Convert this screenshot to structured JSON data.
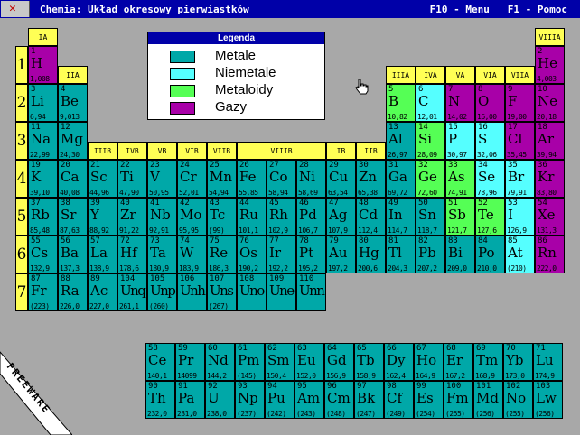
{
  "window": {
    "title": "Chemia: Układ okresowy pierwiastków",
    "menu_hint": "F10 - Menu",
    "help_hint": "F1 - Pomoc"
  },
  "legend": {
    "title": "Legenda",
    "items": [
      {
        "label": "Metale",
        "color": "#00a8a8"
      },
      {
        "label": "Niemetale",
        "color": "#55ffff"
      },
      {
        "label": "Metaloidy",
        "color": "#55ff55"
      },
      {
        "label": "Gazy",
        "color": "#a800a8"
      }
    ]
  },
  "colors": {
    "background": "#a8a8a8",
    "titlebar": "#0000a8",
    "group_header": "#ffff55"
  },
  "banner": "FREEWARE",
  "periods": [
    "1",
    "2",
    "3",
    "4",
    "5",
    "6",
    "7"
  ],
  "groups": {
    "IA": "IA",
    "IIA": "IIA",
    "IIIB": "IIIB",
    "IVB": "IVB",
    "VB": "VB",
    "VIB": "VIB",
    "VIIB": "VIIB",
    "VIIIB": "VIIIB",
    "IB": "IB",
    "IIB": "IIB",
    "IIIA": "IIIA",
    "IVA": "IVA",
    "VA": "VA",
    "VIA": "VIA",
    "VIIA": "VIIA",
    "VIIIA": "VIIIA"
  },
  "elements": [
    {
      "n": "1",
      "s": "H",
      "m": "1,008",
      "t": "gas",
      "c": 0,
      "r": 0
    },
    {
      "n": "2",
      "s": "He",
      "m": "4,003",
      "t": "gas",
      "c": 17,
      "r": 0
    },
    {
      "n": "3",
      "s": "Li",
      "m": "6,94",
      "t": "met",
      "c": 0,
      "r": 1
    },
    {
      "n": "4",
      "s": "Be",
      "m": "9,013",
      "t": "met",
      "c": 1,
      "r": 1
    },
    {
      "n": "5",
      "s": "B",
      "m": "10,82",
      "t": "mtd",
      "c": 12,
      "r": 1
    },
    {
      "n": "6",
      "s": "C",
      "m": "12,01",
      "t": "non",
      "c": 13,
      "r": 1
    },
    {
      "n": "7",
      "s": "N",
      "m": "14,02",
      "t": "gas",
      "c": 14,
      "r": 1
    },
    {
      "n": "8",
      "s": "O",
      "m": "16,00",
      "t": "gas",
      "c": 15,
      "r": 1
    },
    {
      "n": "9",
      "s": "F",
      "m": "19,00",
      "t": "gas",
      "c": 16,
      "r": 1
    },
    {
      "n": "10",
      "s": "Ne",
      "m": "20,18",
      "t": "gas",
      "c": 17,
      "r": 1
    },
    {
      "n": "11",
      "s": "Na",
      "m": "22,99",
      "t": "met",
      "c": 0,
      "r": 2
    },
    {
      "n": "12",
      "s": "Mg",
      "m": "24,30",
      "t": "met",
      "c": 1,
      "r": 2
    },
    {
      "n": "13",
      "s": "Al",
      "m": "26,97",
      "t": "met",
      "c": 12,
      "r": 2
    },
    {
      "n": "14",
      "s": "Si",
      "m": "28,09",
      "t": "mtd",
      "c": 13,
      "r": 2
    },
    {
      "n": "15",
      "s": "P",
      "m": "30,97",
      "t": "non",
      "c": 14,
      "r": 2
    },
    {
      "n": "16",
      "s": "S",
      "m": "32,06",
      "t": "non",
      "c": 15,
      "r": 2
    },
    {
      "n": "17",
      "s": "Cl",
      "m": "35,45",
      "t": "gas",
      "c": 16,
      "r": 2
    },
    {
      "n": "18",
      "s": "Ar",
      "m": "39,94",
      "t": "gas",
      "c": 17,
      "r": 2
    },
    {
      "n": "19",
      "s": "K",
      "m": "39,10",
      "t": "met",
      "c": 0,
      "r": 3
    },
    {
      "n": "20",
      "s": "Ca",
      "m": "40,08",
      "t": "met",
      "c": 1,
      "r": 3
    },
    {
      "n": "21",
      "s": "Sc",
      "m": "44,96",
      "t": "met",
      "c": 2,
      "r": 3
    },
    {
      "n": "22",
      "s": "Ti",
      "m": "47,90",
      "t": "met",
      "c": 3,
      "r": 3
    },
    {
      "n": "23",
      "s": "V",
      "m": "50,95",
      "t": "met",
      "c": 4,
      "r": 3
    },
    {
      "n": "24",
      "s": "Cr",
      "m": "52,01",
      "t": "met",
      "c": 5,
      "r": 3
    },
    {
      "n": "25",
      "s": "Mn",
      "m": "54,94",
      "t": "met",
      "c": 6,
      "r": 3
    },
    {
      "n": "26",
      "s": "Fe",
      "m": "55,85",
      "t": "met",
      "c": 7,
      "r": 3
    },
    {
      "n": "27",
      "s": "Co",
      "m": "58,94",
      "t": "met",
      "c": 8,
      "r": 3
    },
    {
      "n": "28",
      "s": "Ni",
      "m": "58,69",
      "t": "met",
      "c": 9,
      "r": 3
    },
    {
      "n": "29",
      "s": "Cu",
      "m": "63,54",
      "t": "met",
      "c": 10,
      "r": 3
    },
    {
      "n": "30",
      "s": "Zn",
      "m": "65,38",
      "t": "met",
      "c": 11,
      "r": 3
    },
    {
      "n": "31",
      "s": "Ga",
      "m": "69,72",
      "t": "met",
      "c": 12,
      "r": 3
    },
    {
      "n": "32",
      "s": "Ge",
      "m": "72,60",
      "t": "mtd",
      "c": 13,
      "r": 3
    },
    {
      "n": "33",
      "s": "As",
      "m": "74,91",
      "t": "mtd",
      "c": 14,
      "r": 3
    },
    {
      "n": "34",
      "s": "Se",
      "m": "78,96",
      "t": "non",
      "c": 15,
      "r": 3
    },
    {
      "n": "35",
      "s": "Br",
      "m": "79,91",
      "t": "non",
      "c": 16,
      "r": 3
    },
    {
      "n": "36",
      "s": "Kr",
      "m": "83,80",
      "t": "gas",
      "c": 17,
      "r": 3
    },
    {
      "n": "37",
      "s": "Rb",
      "m": "85,48",
      "t": "met",
      "c": 0,
      "r": 4
    },
    {
      "n": "38",
      "s": "Sr",
      "m": "87,63",
      "t": "met",
      "c": 1,
      "r": 4
    },
    {
      "n": "39",
      "s": "Y",
      "m": "88,92",
      "t": "met",
      "c": 2,
      "r": 4
    },
    {
      "n": "40",
      "s": "Zr",
      "m": "91,22",
      "t": "met",
      "c": 3,
      "r": 4
    },
    {
      "n": "41",
      "s": "Nb",
      "m": "92,91",
      "t": "met",
      "c": 4,
      "r": 4
    },
    {
      "n": "42",
      "s": "Mo",
      "m": "95,95",
      "t": "met",
      "c": 5,
      "r": 4
    },
    {
      "n": "43",
      "s": "Tc",
      "m": "(99)",
      "t": "met",
      "c": 6,
      "r": 4
    },
    {
      "n": "44",
      "s": "Ru",
      "m": "101,1",
      "t": "met",
      "c": 7,
      "r": 4
    },
    {
      "n": "45",
      "s": "Rh",
      "m": "102,9",
      "t": "met",
      "c": 8,
      "r": 4
    },
    {
      "n": "46",
      "s": "Pd",
      "m": "106,7",
      "t": "met",
      "c": 9,
      "r": 4
    },
    {
      "n": "47",
      "s": "Ag",
      "m": "107,9",
      "t": "met",
      "c": 10,
      "r": 4
    },
    {
      "n": "48",
      "s": "Cd",
      "m": "112,4",
      "t": "met",
      "c": 11,
      "r": 4
    },
    {
      "n": "49",
      "s": "In",
      "m": "114,7",
      "t": "met",
      "c": 12,
      "r": 4
    },
    {
      "n": "50",
      "s": "Sn",
      "m": "118,7",
      "t": "met",
      "c": 13,
      "r": 4
    },
    {
      "n": "51",
      "s": "Sb",
      "m": "121,7",
      "t": "mtd",
      "c": 14,
      "r": 4
    },
    {
      "n": "52",
      "s": "Te",
      "m": "127,6",
      "t": "mtd",
      "c": 15,
      "r": 4
    },
    {
      "n": "53",
      "s": "I",
      "m": "126,9",
      "t": "non",
      "c": 16,
      "r": 4
    },
    {
      "n": "54",
      "s": "Xe",
      "m": "131,3",
      "t": "gas",
      "c": 17,
      "r": 4
    },
    {
      "n": "55",
      "s": "Cs",
      "m": "132,9",
      "t": "met",
      "c": 0,
      "r": 5
    },
    {
      "n": "56",
      "s": "Ba",
      "m": "137,3",
      "t": "met",
      "c": 1,
      "r": 5
    },
    {
      "n": "57",
      "s": "La",
      "m": "138,9",
      "t": "met",
      "c": 2,
      "r": 5
    },
    {
      "n": "72",
      "s": "Hf",
      "m": "178,6",
      "t": "met",
      "c": 3,
      "r": 5
    },
    {
      "n": "73",
      "s": "Ta",
      "m": "180,9",
      "t": "met",
      "c": 4,
      "r": 5
    },
    {
      "n": "74",
      "s": "W",
      "m": "183,9",
      "t": "met",
      "c": 5,
      "r": 5
    },
    {
      "n": "75",
      "s": "Re",
      "m": "186,3",
      "t": "met",
      "c": 6,
      "r": 5
    },
    {
      "n": "76",
      "s": "Os",
      "m": "190,2",
      "t": "met",
      "c": 7,
      "r": 5
    },
    {
      "n": "77",
      "s": "Ir",
      "m": "192,2",
      "t": "met",
      "c": 8,
      "r": 5
    },
    {
      "n": "78",
      "s": "Pt",
      "m": "195,2",
      "t": "met",
      "c": 9,
      "r": 5
    },
    {
      "n": "79",
      "s": "Au",
      "m": "197,2",
      "t": "met",
      "c": 10,
      "r": 5
    },
    {
      "n": "80",
      "s": "Hg",
      "m": "200,6",
      "t": "met",
      "c": 11,
      "r": 5
    },
    {
      "n": "81",
      "s": "Tl",
      "m": "204,3",
      "t": "met",
      "c": 12,
      "r": 5
    },
    {
      "n": "82",
      "s": "Pb",
      "m": "207,2",
      "t": "met",
      "c": 13,
      "r": 5
    },
    {
      "n": "83",
      "s": "Bi",
      "m": "209,0",
      "t": "met",
      "c": 14,
      "r": 5
    },
    {
      "n": "84",
      "s": "Po",
      "m": "210,0",
      "t": "met",
      "c": 15,
      "r": 5
    },
    {
      "n": "85",
      "s": "At",
      "m": "(210)",
      "t": "non",
      "c": 16,
      "r": 5
    },
    {
      "n": "86",
      "s": "Rn",
      "m": "222,0",
      "t": "gas",
      "c": 17,
      "r": 5
    },
    {
      "n": "87",
      "s": "Fr",
      "m": "(223)",
      "t": "met",
      "c": 0,
      "r": 6
    },
    {
      "n": "88",
      "s": "Ra",
      "m": "226,0",
      "t": "met",
      "c": 1,
      "r": 6
    },
    {
      "n": "89",
      "s": "Ac",
      "m": "227,0",
      "t": "met",
      "c": 2,
      "r": 6
    },
    {
      "n": "104",
      "s": "Unq",
      "m": "261,1",
      "t": "met",
      "c": 3,
      "r": 6
    },
    {
      "n": "105",
      "s": "Unp",
      "m": "(260)",
      "t": "met",
      "c": 4,
      "r": 6
    },
    {
      "n": "106",
      "s": "Unh",
      "m": "",
      "t": "met",
      "c": 5,
      "r": 6
    },
    {
      "n": "107",
      "s": "Uns",
      "m": "(267)",
      "t": "met",
      "c": 6,
      "r": 6
    },
    {
      "n": "108",
      "s": "Uno",
      "m": "",
      "t": "met",
      "c": 7,
      "r": 6
    },
    {
      "n": "109",
      "s": "Une",
      "m": "",
      "t": "met",
      "c": 8,
      "r": 6
    },
    {
      "n": "110",
      "s": "Unn",
      "m": "",
      "t": "met",
      "c": 9,
      "r": 6
    },
    {
      "n": "58",
      "s": "Ce",
      "m": "140,1",
      "t": "met",
      "c": 0,
      "r": 0,
      "f": 1
    },
    {
      "n": "59",
      "s": "Pr",
      "m": "14099",
      "t": "met",
      "c": 1,
      "r": 0,
      "f": 1
    },
    {
      "n": "60",
      "s": "Nd",
      "m": "144,2",
      "t": "met",
      "c": 2,
      "r": 0,
      "f": 1
    },
    {
      "n": "61",
      "s": "Pm",
      "m": "(145)",
      "t": "met",
      "c": 3,
      "r": 0,
      "f": 1
    },
    {
      "n": "62",
      "s": "Sm",
      "m": "150,4",
      "t": "met",
      "c": 4,
      "r": 0,
      "f": 1
    },
    {
      "n": "63",
      "s": "Eu",
      "m": "152,0",
      "t": "met",
      "c": 5,
      "r": 0,
      "f": 1
    },
    {
      "n": "64",
      "s": "Gd",
      "m": "156,9",
      "t": "met",
      "c": 6,
      "r": 0,
      "f": 1
    },
    {
      "n": "65",
      "s": "Tb",
      "m": "158,9",
      "t": "met",
      "c": 7,
      "r": 0,
      "f": 1
    },
    {
      "n": "66",
      "s": "Dy",
      "m": "162,4",
      "t": "met",
      "c": 8,
      "r": 0,
      "f": 1
    },
    {
      "n": "67",
      "s": "Ho",
      "m": "164,9",
      "t": "met",
      "c": 9,
      "r": 0,
      "f": 1
    },
    {
      "n": "68",
      "s": "Er",
      "m": "167,2",
      "t": "met",
      "c": 10,
      "r": 0,
      "f": 1
    },
    {
      "n": "69",
      "s": "Tm",
      "m": "168,9",
      "t": "met",
      "c": 11,
      "r": 0,
      "f": 1
    },
    {
      "n": "70",
      "s": "Yb",
      "m": "173,0",
      "t": "met",
      "c": 12,
      "r": 0,
      "f": 1
    },
    {
      "n": "71",
      "s": "Lu",
      "m": "174,9",
      "t": "met",
      "c": 13,
      "r": 0,
      "f": 1
    },
    {
      "n": "90",
      "s": "Th",
      "m": "232,0",
      "t": "met",
      "c": 0,
      "r": 1,
      "f": 1
    },
    {
      "n": "91",
      "s": "Pa",
      "m": "231,0",
      "t": "met",
      "c": 1,
      "r": 1,
      "f": 1
    },
    {
      "n": "92",
      "s": "U",
      "m": "238,0",
      "t": "met",
      "c": 2,
      "r": 1,
      "f": 1
    },
    {
      "n": "93",
      "s": "Np",
      "m": "(237)",
      "t": "met",
      "c": 3,
      "r": 1,
      "f": 1
    },
    {
      "n": "94",
      "s": "Pu",
      "m": "(242)",
      "t": "met",
      "c": 4,
      "r": 1,
      "f": 1
    },
    {
      "n": "95",
      "s": "Am",
      "m": "(243)",
      "t": "met",
      "c": 5,
      "r": 1,
      "f": 1
    },
    {
      "n": "96",
      "s": "Cm",
      "m": "(248)",
      "t": "met",
      "c": 6,
      "r": 1,
      "f": 1
    },
    {
      "n": "97",
      "s": "Bk",
      "m": "(247)",
      "t": "met",
      "c": 7,
      "r": 1,
      "f": 1
    },
    {
      "n": "98",
      "s": "Cf",
      "m": "(249)",
      "t": "met",
      "c": 8,
      "r": 1,
      "f": 1
    },
    {
      "n": "99",
      "s": "Es",
      "m": "(254)",
      "t": "met",
      "c": 9,
      "r": 1,
      "f": 1
    },
    {
      "n": "100",
      "s": "Fm",
      "m": "(255)",
      "t": "met",
      "c": 10,
      "r": 1,
      "f": 1
    },
    {
      "n": "101",
      "s": "Md",
      "m": "(256)",
      "t": "met",
      "c": 11,
      "r": 1,
      "f": 1
    },
    {
      "n": "102",
      "s": "No",
      "m": "(255)",
      "t": "met",
      "c": 12,
      "r": 1,
      "f": 1
    },
    {
      "n": "103",
      "s": "Lw",
      "m": "(256)",
      "t": "met",
      "c": 13,
      "r": 1,
      "f": 1
    }
  ]
}
